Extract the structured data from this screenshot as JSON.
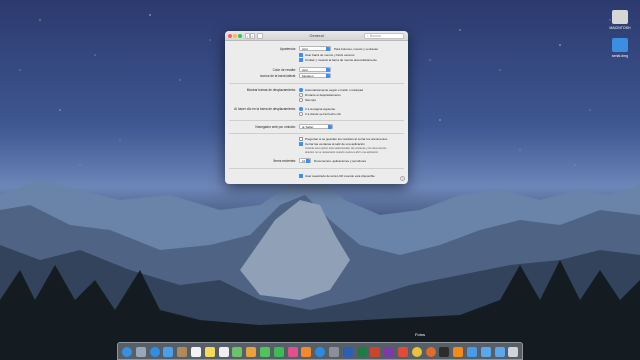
{
  "desktop": {
    "icons": [
      {
        "label": "MACINTOSH",
        "color": "#d6d6d6"
      },
      {
        "label": "serial.dmg",
        "color": "#3a8fe0"
      }
    ]
  },
  "window": {
    "title": "General",
    "search_placeholder": "Buscar",
    "appearance": {
      "label": "Apariencia:",
      "value": "Azul",
      "note": "Para botones, menús y ventanas",
      "opt1": "Usar barra de menús y Dock oscuros",
      "opt2": "Ocultar y mostrar la barra de menús automáticamente"
    },
    "highlight": {
      "label": "Color de resalte:",
      "value": "Azul"
    },
    "sidebar_icons": {
      "label": "Iconos de la barra lateral:",
      "value": "Mediano"
    },
    "scrollbars": {
      "label": "Mostrar barras de desplazamiento:",
      "options": [
        "Automáticamente según el ratón o trackpad",
        "Durante el desplazamiento",
        "Siempre"
      ]
    },
    "scrollbar_click": {
      "label": "Al hacer clic en la barra de desplazamiento:",
      "options": [
        "Ir a la página siguiente",
        "Ir a donde se ha hecho clic"
      ]
    },
    "browser": {
      "label": "Navegador web por omisión:",
      "value": "Safari"
    },
    "documents": {
      "opt1": "Preguntar si se guardan los cambios al cerrar los documentos",
      "opt2": "Cerrar las ventanas al salir de una aplicación",
      "desc1": "Cuando esta opción está seleccionada, las ventanas y los documentos",
      "desc2": "abiertos no se restaurarán cuando vuelva a abrir una aplicación."
    },
    "recent": {
      "label": "Ítems recientes:",
      "value": "10",
      "note": "Documentos, aplicaciones y servidores"
    },
    "lcd": {
      "label": "Usar suavizado de letra LCD cuando esté disponible"
    },
    "help": "?"
  },
  "dock": {
    "tooltip": "Fotos",
    "icons": [
      {
        "name": "finder",
        "color": "#3b8fe0"
      },
      {
        "name": "launchpad",
        "color": "#9aa5b5"
      },
      {
        "name": "safari",
        "color": "#2f8ee6"
      },
      {
        "name": "mail",
        "color": "#4aa0e8"
      },
      {
        "name": "contacts",
        "color": "#b08a5a"
      },
      {
        "name": "calendar",
        "color": "#f2f2f2"
      },
      {
        "name": "notes",
        "color": "#f5d95a"
      },
      {
        "name": "reminders",
        "color": "#efefef"
      },
      {
        "name": "maps",
        "color": "#6cc36b"
      },
      {
        "name": "photos",
        "color": "#e8a13c"
      },
      {
        "name": "messages",
        "color": "#4fc35c"
      },
      {
        "name": "facetime",
        "color": "#3dbb55"
      },
      {
        "name": "itunes",
        "color": "#e0508a"
      },
      {
        "name": "ibooks",
        "color": "#f08a2a"
      },
      {
        "name": "appstore",
        "color": "#2d8be0"
      },
      {
        "name": "preferences",
        "color": "#8a8f99"
      },
      {
        "name": "word",
        "color": "#2b5fb4"
      },
      {
        "name": "excel",
        "color": "#1f7a45"
      },
      {
        "name": "powerpoint",
        "color": "#c9452b"
      },
      {
        "name": "onenote",
        "color": "#7b3aa6"
      },
      {
        "name": "gmail",
        "color": "#e04a3a"
      },
      {
        "name": "chrome",
        "color": "#e8c33a"
      },
      {
        "name": "firefox",
        "color": "#e66b2a"
      },
      {
        "name": "terminal",
        "color": "#2c2c2c"
      },
      {
        "name": "vlc",
        "color": "#f28a1a"
      },
      {
        "name": "preview",
        "color": "#4a9be6"
      },
      {
        "name": "documents-folder",
        "color": "#5aa7ea"
      },
      {
        "name": "downloads-folder",
        "color": "#5aa7ea"
      },
      {
        "name": "trash",
        "color": "#cfd4da"
      }
    ]
  }
}
